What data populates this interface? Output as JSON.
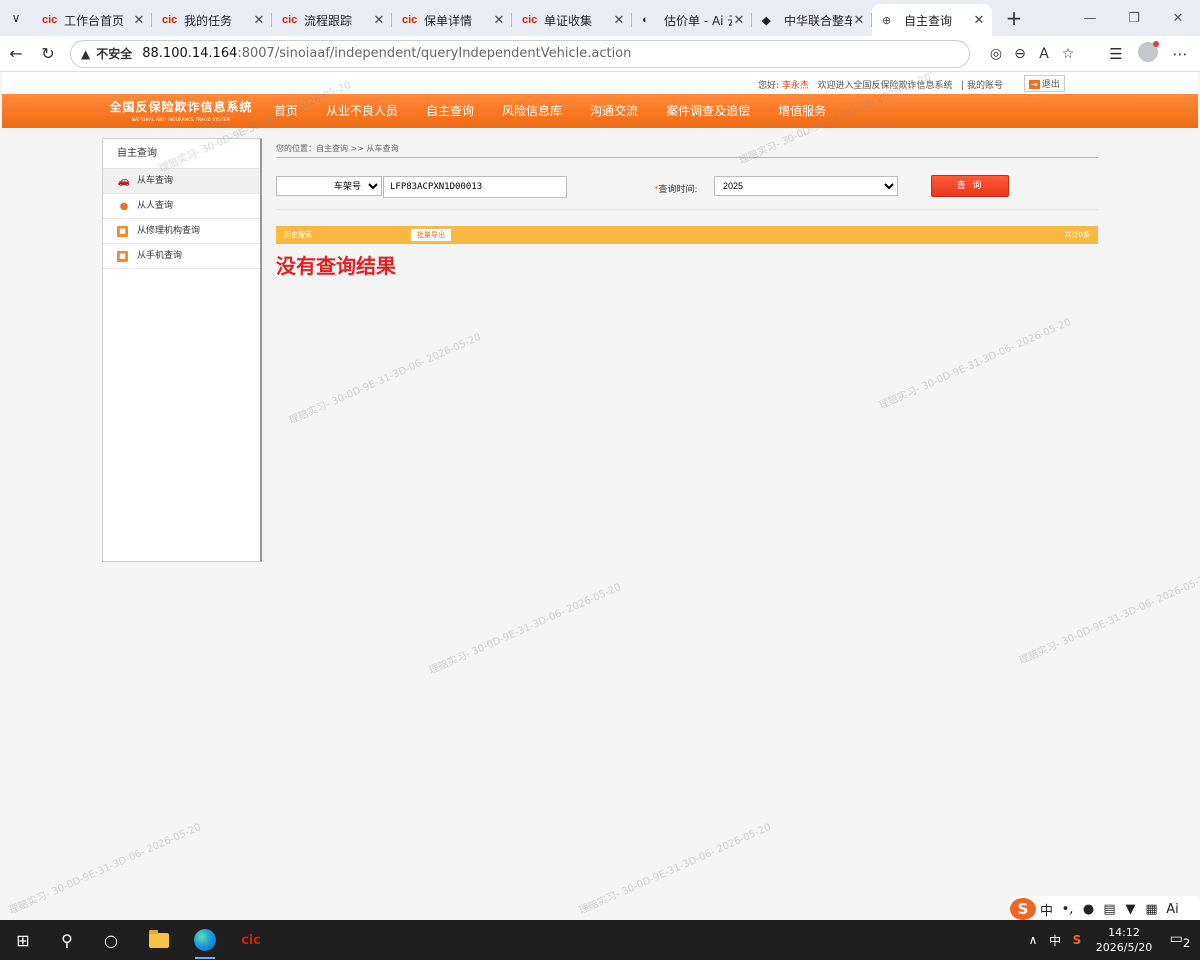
{
  "browser": {
    "tabs": [
      {
        "favicon": "cic-logo-icon",
        "label": "工作台首页",
        "active": false
      },
      {
        "favicon": "cic-logo-icon",
        "label": "我的任务",
        "active": false
      },
      {
        "favicon": "cic-logo-icon",
        "label": "流程跟踪",
        "active": false
      },
      {
        "favicon": "cic-logo-icon",
        "label": "保单详情",
        "active": false
      },
      {
        "favicon": "cic-logo-icon",
        "label": "单证收集",
        "active": false
      },
      {
        "favicon": "ai-logo-icon",
        "label": "估价单 - Ai 云",
        "active": false
      },
      {
        "favicon": "car-icon",
        "label": "中华联合整车",
        "active": false
      },
      {
        "favicon": "globe-icon",
        "label": "自主查询",
        "active": true
      }
    ],
    "address": {
      "security_label": "不安全",
      "host": "88.100.14.164",
      "path": ":8007/sinoiaaf/independent/queryIndependentVehicle.action"
    }
  },
  "site": {
    "greeting_prefix": "您好:",
    "user_name": "李永杰",
    "welcome": "欢迎进入全国反保险欺诈信息系统",
    "my_account": "| 我的账号",
    "logout": "退出",
    "logo_cn": "全国反保险欺诈信息系统",
    "logo_en": "NATIONAL ANTI INSURANCE FRAUD SYSTEM",
    "nav": [
      "首页",
      "从业不良人员",
      "自主查询",
      "风险信息库",
      "沟通交流",
      "案件调查及追偿",
      "增值服务"
    ]
  },
  "sidebar": {
    "title": "自主查询",
    "items": [
      {
        "label": "从车查询",
        "icon": "car-icon"
      },
      {
        "label": "从人查询",
        "icon": "person-icon"
      },
      {
        "label": "从修理机构查询",
        "icon": "repair-shop-icon"
      },
      {
        "label": "从手机查询",
        "icon": "phone-icon"
      }
    ]
  },
  "query": {
    "breadcrumb": "您的位置：自主查询 >> 从车查询",
    "id_type": "车架号",
    "vin_value": "LFP83ACPXN1D00013",
    "time_label": "查询时间:",
    "time_value": "2025",
    "submit_label": "查 询"
  },
  "results": {
    "history_label": "历史搜索",
    "export_label": "批量导出",
    "total_label": "共计0条",
    "empty_message": "没有查询结果"
  },
  "watermark": "理赔实习- 30-0D-9E-31-3D-06- 2026-05-20",
  "ime": {
    "lang": "中"
  },
  "taskbar": {
    "tray_lang": "中",
    "time": "14:12",
    "date": "2026/5/20",
    "notifications": "2"
  }
}
